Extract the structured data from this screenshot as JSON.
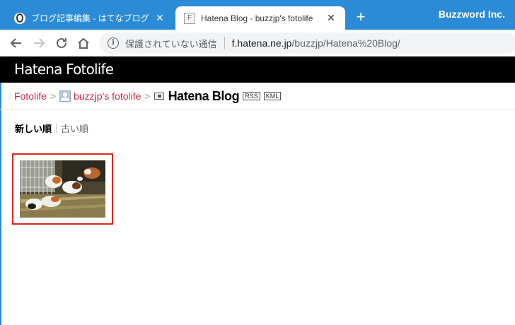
{
  "browser": {
    "tabs": [
      {
        "title": "ブログ記事編集 - はてなブログ",
        "active": false
      },
      {
        "title": "Hatena Blog - buzzjp's fotolife",
        "active": true
      }
    ],
    "close_glyph": "✕",
    "new_tab_glyph": "+",
    "brand": "Buzzword Inc.",
    "security_label": "保護されていない通信",
    "url_host": "f.hatena.ne.jp",
    "url_path": "/buzzjp/Hatena%20Blog/"
  },
  "site": {
    "logo": "Hatena Fotolife"
  },
  "breadcrumb": {
    "root": "Fotolife",
    "separator": ">",
    "user": "buzzjp's fotolife",
    "folder": "Hatena Blog",
    "rss": "RSS",
    "kml": "KML"
  },
  "sort": {
    "newest": "新しい順",
    "oldest": "古い順"
  },
  "colors": {
    "tabstrip": "#2b8bd6",
    "header": "#000000",
    "link": "#c5283f",
    "selection": "#e0271f"
  }
}
